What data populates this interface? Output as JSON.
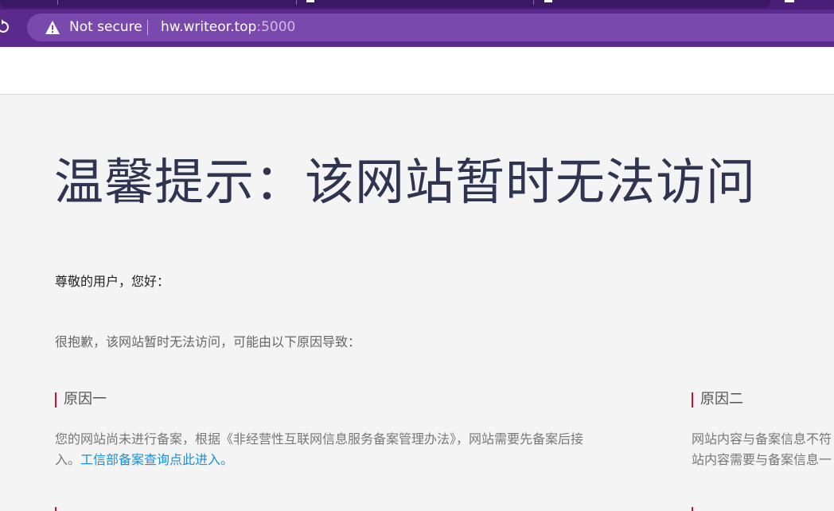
{
  "browser": {
    "security_label": "Not secure",
    "url_host": "hw.writeor.top",
    "url_port": ":5000"
  },
  "page": {
    "headline": "温馨提示：该网站暂时无法访问",
    "greeting": "尊敬的用户，您好：",
    "apology": "很抱歉，该网站暂时无法访问，可能由以下原因导致：",
    "reason1": {
      "title": "原因一",
      "body_line1": "您的网站尚未进行备案，根据《非经营性互联网信息服务备案管理办法》，网站需要先备案后接",
      "body_line2_prefix": "入。",
      "link_text": "工信部备案查询点此进入。"
    },
    "reason2": {
      "title": "原因二",
      "body_line1": "网站内容与备案信息不符",
      "body_line2": "站内容需要与备案信息一"
    }
  },
  "colors": {
    "accent_red": "#d0112b",
    "link_blue": "#1a8fd6",
    "headline": "#2f3450",
    "browser_purple": "#5b2a8f"
  }
}
